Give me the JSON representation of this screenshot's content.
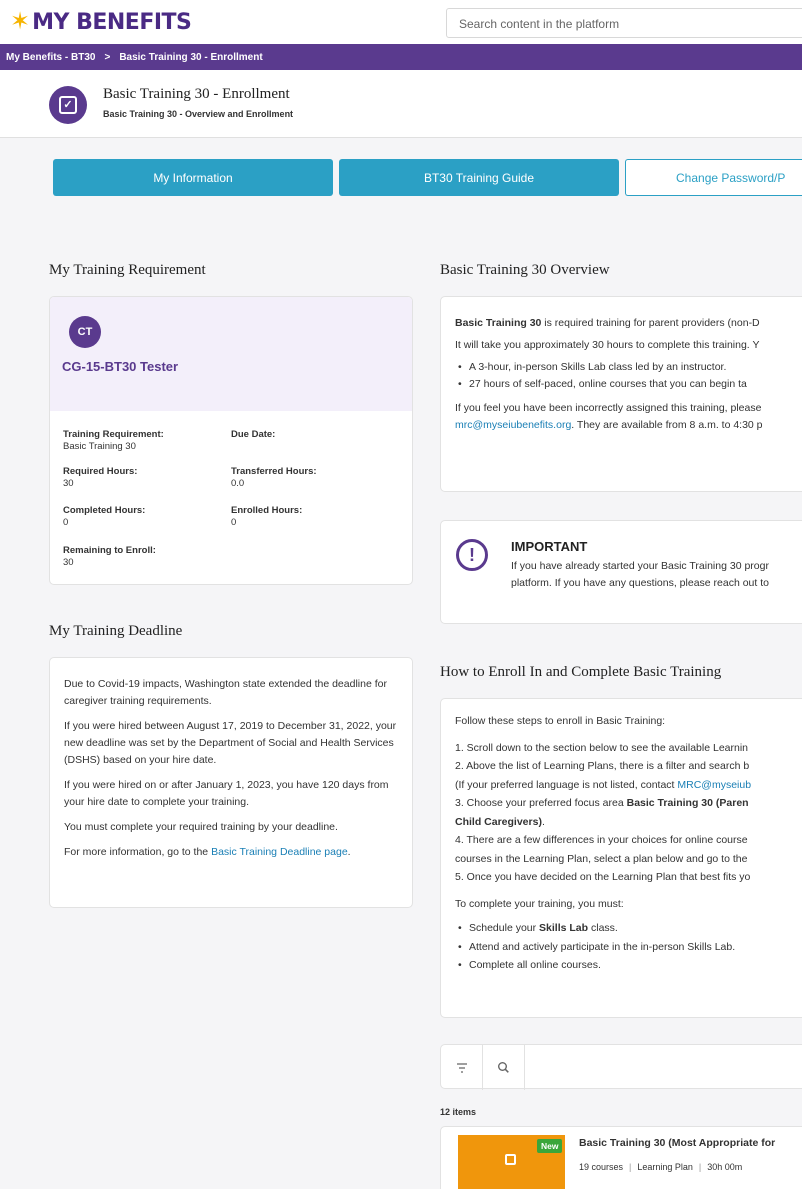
{
  "brand": {
    "logo_text": "MY BENEFITS"
  },
  "search": {
    "placeholder": "Search content in the platform"
  },
  "breadcrumb": {
    "root": "My Benefits - BT30",
    "separator": ">",
    "current": "Basic Training 30 - Enrollment"
  },
  "page": {
    "title": "Basic Training 30 - Enrollment",
    "subtitle": "Basic Training 30 - Overview and Enrollment",
    "icon": "shield-check-icon"
  },
  "nav": {
    "my_information": "My Information",
    "training_guide": "BT30 Training Guide",
    "change_password": "Change Password/P"
  },
  "requirement": {
    "section_title": "My Training Requirement",
    "avatar_initials": "CT",
    "user_name": "CG-15-BT30 Tester",
    "training_requirement_label": "Training Requirement:",
    "training_requirement_value": "Basic Training 30",
    "due_date_label": "Due Date:",
    "due_date_value": "",
    "required_hours_label": "Required Hours:",
    "required_hours_value": "30",
    "transferred_hours_label": "Transferred Hours:",
    "transferred_hours_value": "0.0",
    "completed_hours_label": "Completed Hours:",
    "completed_hours_value": "0",
    "enrolled_hours_label": "Enrolled Hours:",
    "enrolled_hours_value": "0",
    "remaining_label": "Remaining to Enroll:",
    "remaining_value": "30"
  },
  "deadline": {
    "section_title": "My Training Deadline",
    "p1": "Due to Covid-19 impacts, Washington state extended the deadline for caregiver training requirements.",
    "p2": "If you were hired between August 17, 2019 to December 31, 2022, your new deadline was set by the Department of Social and Health Services (DSHS) based on your hire date.",
    "p3": "If you were hired on or after January 1, 2023, you have 120 days from your hire date to complete your training.",
    "p4": "You must complete your required training by your deadline.",
    "p5_prefix": "For more information, go to the ",
    "p5_link": "Basic Training Deadline page",
    "p5_suffix": "."
  },
  "overview": {
    "section_title": "Basic Training 30 Overview",
    "p1_bold": "Basic Training 30",
    "p1_rest": " is required training for parent providers (non-D",
    "p2": "It will take you approximately 30 hours to complete this training. Y",
    "bullets": [
      "A 3-hour, in-person Skills Lab class led by an instructor.",
      "27 hours of self-paced, online courses that you can begin ta"
    ],
    "p3": "If you feel you have been incorrectly assigned this training, please",
    "p4_link": "mrc@myseiubenefits.org",
    "p4_rest": ". They are available from 8 a.m. to 4:30 p"
  },
  "important": {
    "title": "IMPORTANT",
    "line1": "If you have already started your Basic Training 30 progr",
    "line2": "platform. If you have any questions, please reach out to"
  },
  "enroll": {
    "section_title": "How to Enroll In and Complete Basic Training",
    "intro": "Follow these steps to enroll in Basic Training:",
    "s1": "1. Scroll down to the section below to see the available Learnin",
    "s2": "2. Above the list of Learning Plans, there is a filter and search b",
    "s2b_prefix": "(If your preferred language is not listed, contact ",
    "s2b_link": "MRC@myseiub",
    "s3_prefix": "3. Choose your preferred focus area ",
    "s3_bold": "Basic Training 30 (Paren",
    "s3b_bold": "Child Caregivers)",
    "s3b_rest": ".",
    "s4": "4. There are a few differences in your choices for online course",
    "s4b": "courses in the Learning Plan, select a plan below and go to the",
    "s5": "5. Once you have decided on the Learning Plan that best fits yo",
    "complete_intro": "To complete your training, you must:",
    "c1_prefix": "Schedule your ",
    "c1_bold": "Skills Lab",
    "c1_suffix": " class.",
    "c2": "Attend and actively participate in the in-person Skills Lab.",
    "c3": "Complete all online courses."
  },
  "catalog": {
    "item_count": "12 items",
    "filter_icon": "filter-icon",
    "search_icon": "search-icon",
    "item": {
      "badge": "New",
      "title": "Basic Training 30 (Most Appropriate for",
      "courses": "19 courses",
      "type": "Learning Plan",
      "duration": "30h 00m"
    }
  },
  "colors": {
    "brand_purple": "#5a3a8e",
    "accent_blue": "#2ba0c5",
    "logo_yellow": "#f6b400",
    "thumb_orange": "#f0960c",
    "badge_green": "#3aa63a"
  }
}
